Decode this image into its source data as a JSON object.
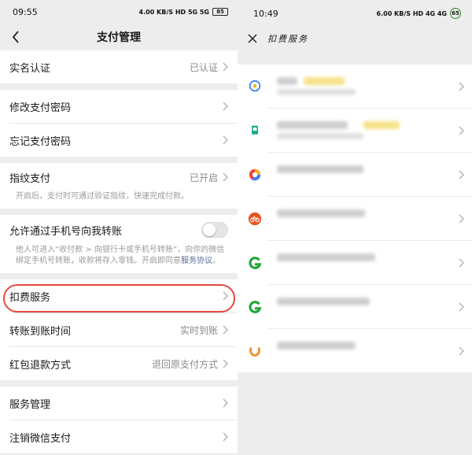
{
  "left": {
    "status_bar": {
      "time": "09:55",
      "indicators": "4.00 KB/S  HD  5G  5G",
      "battery": "85"
    },
    "nav": {
      "title": "支付管理",
      "back_icon": "chevron-left-icon"
    },
    "rows": {
      "real_name": {
        "label": "实名认证",
        "value": "已认证"
      },
      "modify_password": {
        "label": "修改支付密码"
      },
      "forgot_password": {
        "label": "忘记支付密码"
      },
      "fingerprint": {
        "label": "指纹支付",
        "value": "已开启",
        "sub": "开启后，支付时可通过验证指纹，快速完成付款。"
      },
      "phone_transfer": {
        "label": "允许通过手机号向我转账",
        "sub": "他人可进入“收付款 > 向银行卡或手机号转账”，向你的微信绑定手机号转账，收款将存入零钱。开启即同意",
        "sub_link": "服务协议",
        "sub_end": "。",
        "toggle_on": false
      },
      "deduction": {
        "label": "扣费服务"
      },
      "arrival_time": {
        "label": "转账到账时间",
        "value": "实时到账"
      },
      "red_packet_refund": {
        "label": "红包退款方式",
        "value": "退回原支付方式"
      },
      "service_manage": {
        "label": "服务管理"
      },
      "cancel_pay": {
        "label": "注销微信支付"
      }
    }
  },
  "right": {
    "status_bar": {
      "time": "10:49",
      "indicators": "6.00 KB/S  HD  4G  4G",
      "battery": "65"
    },
    "nav": {
      "title": "扣费服务",
      "close_icon": "close-icon"
    },
    "services": [
      {
        "icon": "location-icon",
        "icon_color": "#3b82f6"
      },
      {
        "icon": "app-icon",
        "icon_color": "#1aad8a"
      },
      {
        "icon": "browser-icon",
        "icon_color": "#e8473a"
      },
      {
        "icon": "bike-icon",
        "icon_color": "#e8531f"
      },
      {
        "icon": "g-logo-icon",
        "icon_color": "#22a63a"
      },
      {
        "icon": "g-logo-icon",
        "icon_color": "#22a63a"
      },
      {
        "icon": "didi-icon",
        "icon_color": "#f08a24"
      }
    ]
  },
  "colors": {
    "accent_red": "#e8473a",
    "link": "#576b95",
    "page_bg": "#ededed"
  }
}
